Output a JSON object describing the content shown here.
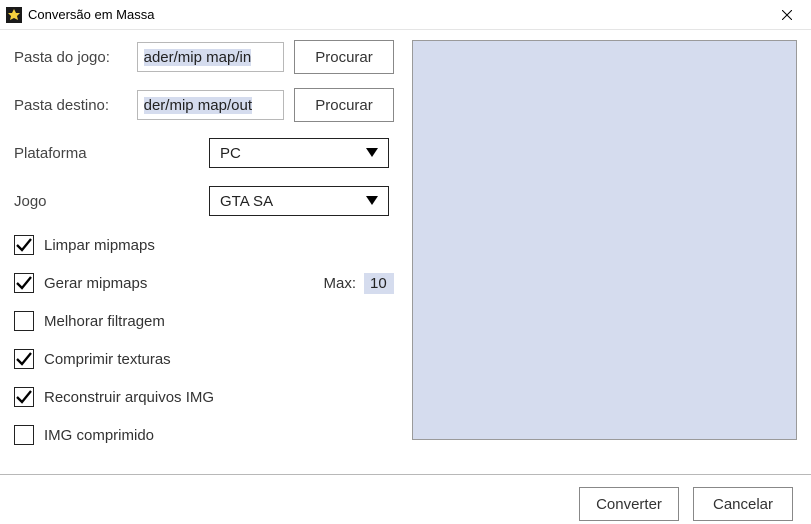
{
  "window": {
    "title": "Conversão em Massa"
  },
  "fields": {
    "game_folder_label": "Pasta do jogo:",
    "game_folder_value": "ader/mip map/in",
    "dest_folder_label": "Pasta destino:",
    "dest_folder_value": "der/mip map/out",
    "browse_label": "Procurar",
    "platform_label": "Plataforma",
    "platform_value": "PC",
    "game_label": "Jogo",
    "game_value": "GTA SA"
  },
  "checks": {
    "clear_mipmaps": {
      "label": "Limpar mipmaps",
      "checked": true
    },
    "gen_mipmaps": {
      "label": "Gerar mipmaps",
      "checked": true
    },
    "max_label": "Max:",
    "max_value": "10",
    "improve_filter": {
      "label": "Melhorar filtragem",
      "checked": false
    },
    "compress_tex": {
      "label": "Comprimir texturas",
      "checked": true
    },
    "rebuild_img": {
      "label": "Reconstruir arquivos IMG",
      "checked": true
    },
    "img_compressed": {
      "label": "IMG comprimido",
      "checked": false
    }
  },
  "footer": {
    "convert": "Converter",
    "cancel": "Cancelar"
  }
}
